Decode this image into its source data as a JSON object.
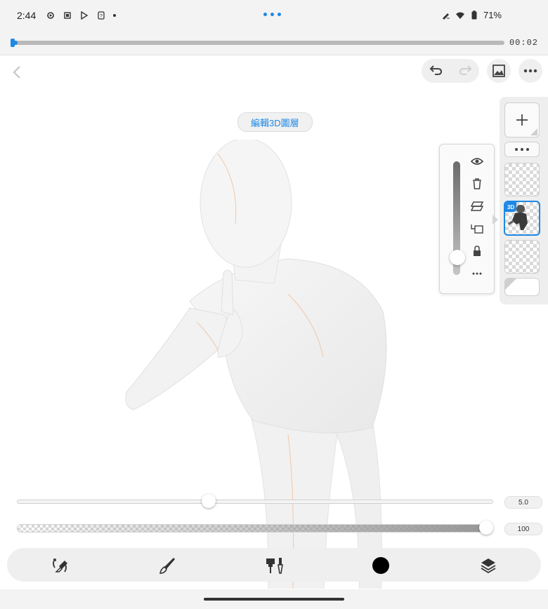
{
  "status_bar": {
    "time": "2:44",
    "battery": "71%",
    "icons": [
      "settings-icon",
      "screen-icon",
      "play-store-icon",
      "unknown-app-icon",
      "pen-icon",
      "wifi-icon",
      "battery-icon"
    ]
  },
  "timeline": {
    "progress": 0.01,
    "timecode": "00:02"
  },
  "canvas": {
    "mode_label": "編輯3D圖層"
  },
  "layers": {
    "add_label": "+",
    "items": [
      {
        "name": "layer-empty-top",
        "badge": ""
      },
      {
        "name": "layer-3d",
        "badge": "3D",
        "selected": true
      },
      {
        "name": "layer-empty-bottom",
        "badge": ""
      }
    ]
  },
  "layer_menu": {
    "opacity_level": 0.1,
    "actions": [
      "eye-icon",
      "trash-icon",
      "clip-icon",
      "move-layer-icon",
      "lock-icon",
      "more-icon"
    ]
  },
  "brush": {
    "size_value": "5.0",
    "size_level": 0.4,
    "opacity_value": "100",
    "opacity_level": 1.0
  },
  "toolbar": {
    "tools": [
      "transform-eraser-icon",
      "brush-icon",
      "brush-settings-icon",
      "color-swatch",
      "layers-icon"
    ],
    "current_color": "#000000"
  },
  "colors": {
    "accent": "#1e88e5"
  }
}
